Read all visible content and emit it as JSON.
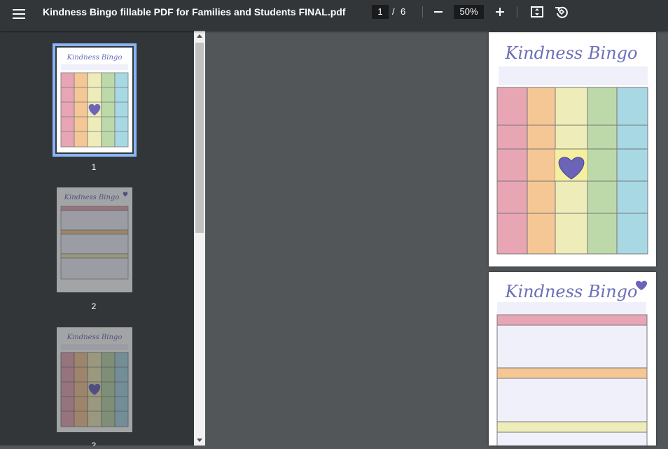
{
  "toolbar": {
    "title": "Kindness Bingo fillable PDF for Families and Students FINAL.pdf",
    "page_current": "1",
    "page_separator": "/",
    "page_total": "6",
    "zoom": "50%"
  },
  "sidebar": {
    "thumbnails": [
      {
        "label": "1"
      },
      {
        "label": "2"
      },
      {
        "label": "3"
      }
    ]
  },
  "document": {
    "page_title": "Kindness Bingo"
  },
  "colors": {
    "pink": "#e8a6b4",
    "orange": "#f4c795",
    "yellow": "#eeecb8",
    "green": "#bdd9a9",
    "blue": "#a8d8e4",
    "heart": "#6b64b8",
    "brand": "#6c6fb8"
  }
}
